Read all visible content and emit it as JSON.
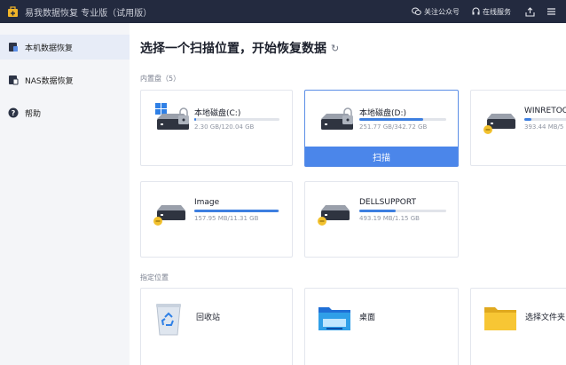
{
  "titlebar": {
    "title": "易我数据恢复 专业版（试用版）",
    "wechat_label": "关注公众号",
    "service_label": "在线服务"
  },
  "sidebar": {
    "items": [
      {
        "label": "本机数据恢复",
        "icon": "local-recovery-icon"
      },
      {
        "label": "NAS数据恢复",
        "icon": "nas-recovery-icon"
      },
      {
        "label": "帮助",
        "icon": "help-icon"
      }
    ]
  },
  "main": {
    "heading": "选择一个扫描位置，开始恢复数据",
    "builtin_label": "内置盘（5）",
    "location_label": "指定位置",
    "scan_label": "扫描",
    "drives": [
      {
        "name": "本地磁盘(C:)",
        "size": "2.30 GB/120.04 GB",
        "fraction": 0.02
      },
      {
        "name": "本地磁盘(D:)",
        "size": "251.77 GB/342.72 GB",
        "fraction": 0.73
      },
      {
        "name": "WINRETOOLS",
        "size": "393.44 MB/5",
        "fraction": 0.08
      },
      {
        "name": "Image",
        "size": "157.95 MB/11.31 GB",
        "fraction": 0.99
      },
      {
        "name": "DELLSUPPORT",
        "size": "493.19 MB/1.15 GB",
        "fraction": 0.42
      }
    ],
    "locations": [
      {
        "name": "回收站",
        "icon": "recycle-bin-icon"
      },
      {
        "name": "桌面",
        "icon": "desktop-folder-icon"
      },
      {
        "name": "选择文件夹",
        "icon": "folder-icon"
      }
    ]
  },
  "colors": {
    "accent": "#4b86ea",
    "titlebar": "#232a3f",
    "sidebar_active": "#e7ecf7",
    "usage_bar": "#3d7fe0"
  }
}
